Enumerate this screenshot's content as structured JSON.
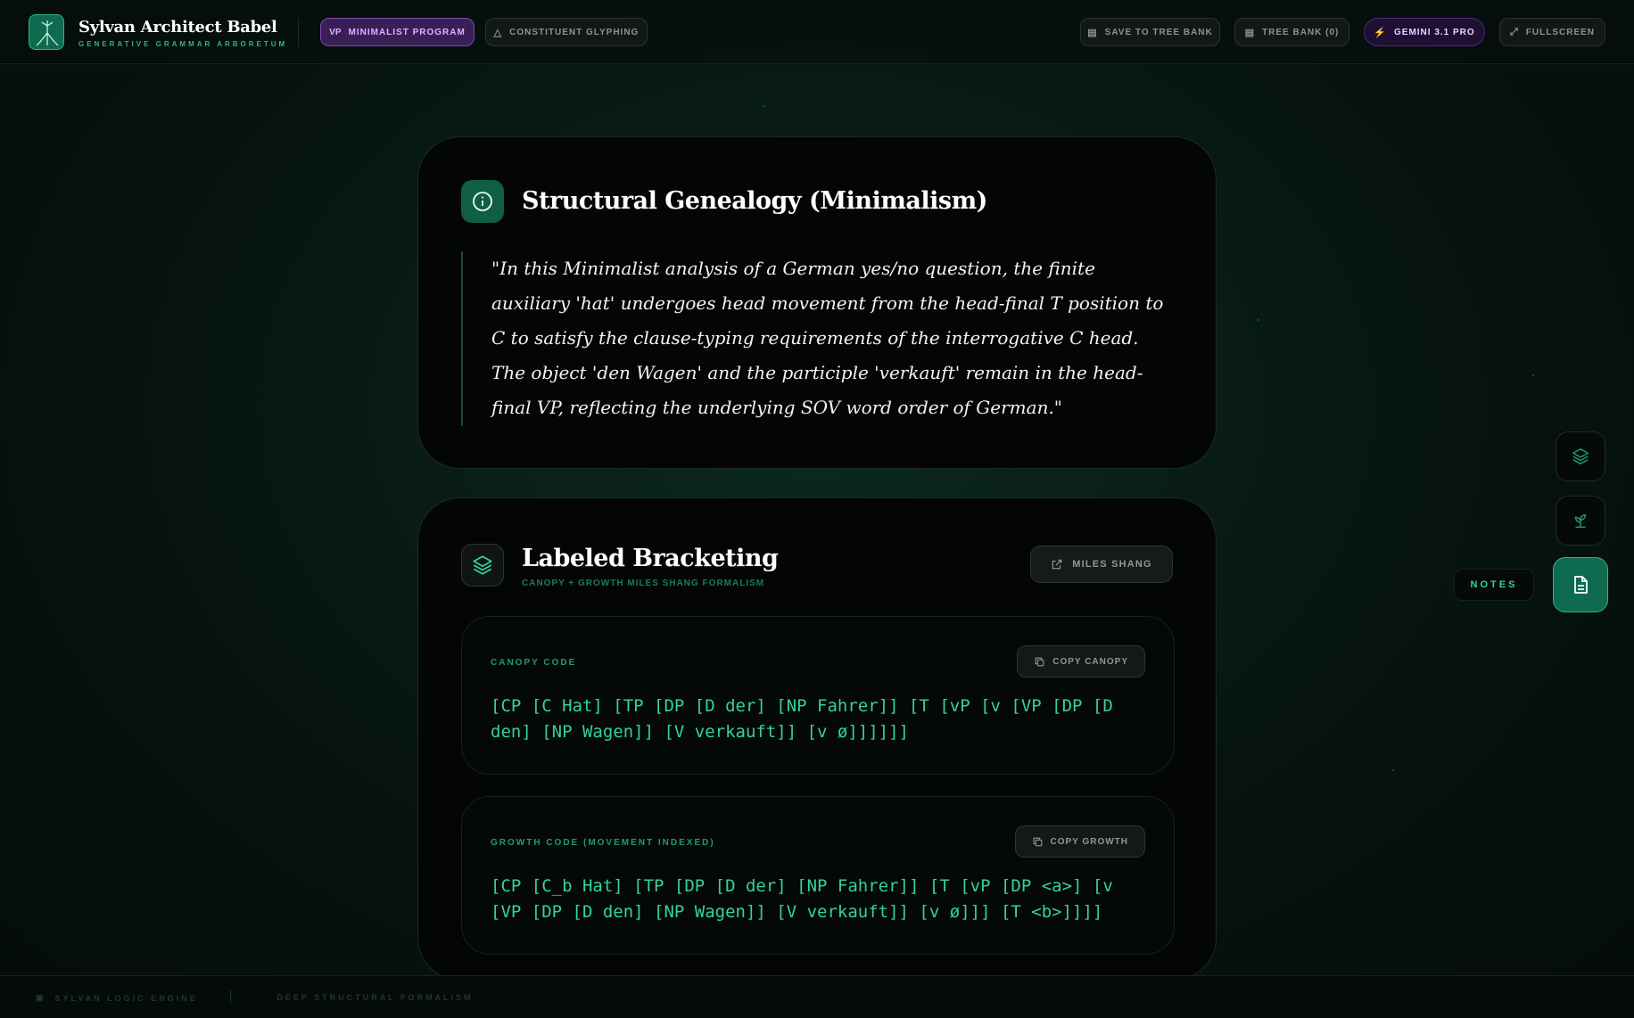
{
  "brand": {
    "title": "Sylvan Architect Babel",
    "subtitle": "GENERATIVE GRAMMAR ARBORETUM"
  },
  "header": {
    "minimalist_prefix": "vP",
    "minimalist_label": "MINIMALIST PROGRAM",
    "constituent_label": "CONSTITUENT GLYPHING",
    "save_label": "SAVE TO TREE BANK",
    "treebank_label": "TREE BANK (0)",
    "model_label": "GEMINI 3.1 PRO",
    "fullscreen_label": "FULLSCREEN"
  },
  "genealogy": {
    "title": "Structural Genealogy (Minimalism)",
    "quote": "\"In this Minimalist analysis of a German yes/no question, the finite auxiliary 'hat' undergoes head movement from the head-final T position to C to satisfy the clause-typing requirements of the interrogative C head. The object 'den Wagen' and the participle 'verkauft' remain in the head-final VP, reflecting the underlying SOV word order of German.\""
  },
  "bracketing": {
    "title": "Labeled Bracketing",
    "subtitle": "CANOPY + GROWTH MILES SHANG FORMALISM",
    "miles_label": "MILES SHANG",
    "canopy": {
      "label": "CANOPY CODE",
      "copy_label": "COPY CANOPY",
      "code": "[CP [C Hat] [TP [DP [D der] [NP Fahrer]] [T [vP [v [VP [DP [D den] [NP Wagen]] [V verkauft]] [v ø]]]]]]"
    },
    "growth": {
      "label": "GROWTH CODE (MOVEMENT INDEXED)",
      "copy_label": "COPY GROWTH",
      "code": "[CP [C_b Hat] [TP [DP [D der] [NP Fahrer]] [T [vP [DP <a>] [v [VP [DP [D den] [NP Wagen]] [V verkauft]] [v ø]]] [T <b>]]]]"
    }
  },
  "rail": {
    "notes_label": "NOTES"
  },
  "footer": {
    "engine_label": "SYLVAN LOGIC ENGINE",
    "formalism_label": "DEEP STRUCTURAL FORMALISM"
  },
  "colors": {
    "accent": "#34d399",
    "accent_dark": "#0f6b4f",
    "purple": "#d8b4fe",
    "background": "#07140f"
  }
}
